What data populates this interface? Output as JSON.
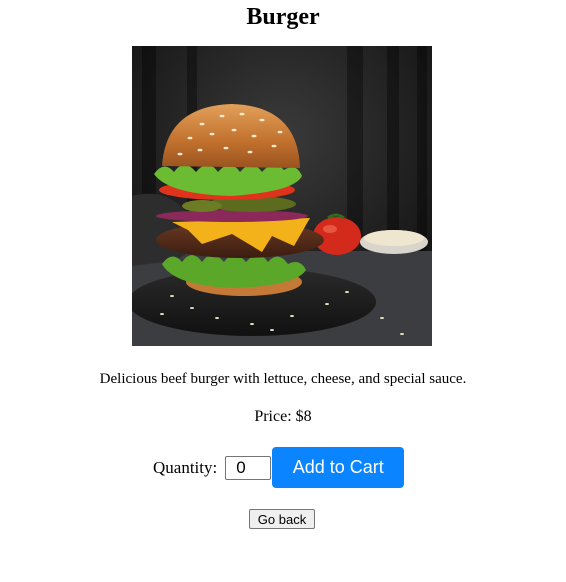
{
  "product": {
    "title": "Burger",
    "image_alt": "Burger",
    "description": "Delicious beef burger with lettuce, cheese, and special sauce.",
    "price_text": "Price: $8"
  },
  "order": {
    "quantity_label": "Quantity:",
    "quantity_value": "0",
    "add_to_cart_label": "Add to Cart"
  },
  "navigation": {
    "back_label": "Go back"
  },
  "colors": {
    "accent": "#0a84ff",
    "button_text": "#ffffff"
  }
}
